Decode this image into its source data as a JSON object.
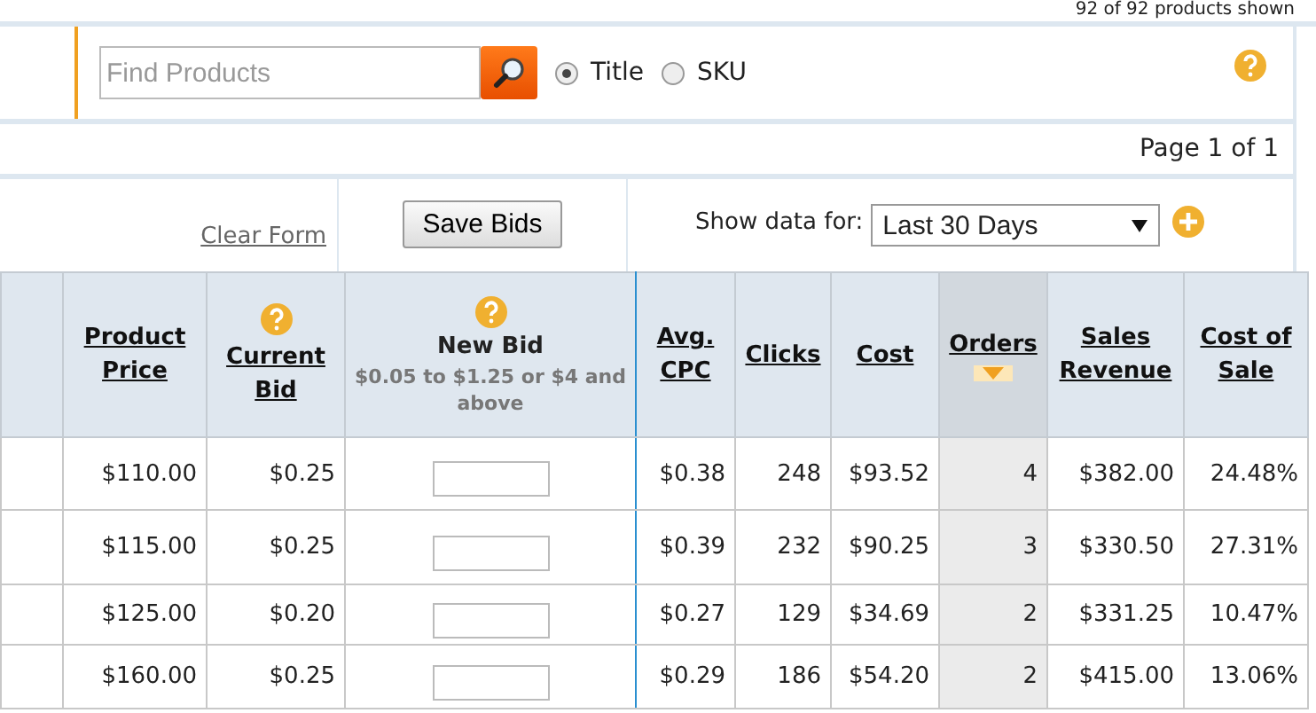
{
  "products_shown": "92 of 92 products shown",
  "search": {
    "placeholder": "Find Products",
    "options": [
      {
        "label": "Title",
        "selected": true
      },
      {
        "label": "SKU",
        "selected": false
      }
    ]
  },
  "pagination": "Page 1 of 1",
  "controls": {
    "clear_form": "Clear Form",
    "save_bids": "Save Bids",
    "show_data_label": "Show data for:",
    "period": "Last 30 Days"
  },
  "table": {
    "columns": [
      {
        "kind": "blank"
      },
      {
        "label": "Product Price",
        "sorted": false,
        "kind": "link"
      },
      {
        "label": "Current Bid",
        "sorted": false,
        "kind": "help-link"
      },
      {
        "label": "New Bid",
        "sorted": false,
        "kind": "help-input",
        "note": "$0.05 to $1.25 or $4 and above"
      },
      {
        "label": "Avg. CPC",
        "sorted": false,
        "kind": "link"
      },
      {
        "label": "Clicks",
        "sorted": false,
        "kind": "link"
      },
      {
        "label": "Cost",
        "sorted": false,
        "kind": "link"
      },
      {
        "label": "Orders",
        "sorted": true,
        "kind": "link"
      },
      {
        "label": "Sales Revenue",
        "sorted": false,
        "kind": "link"
      },
      {
        "label": "Cost of Sale",
        "sorted": false,
        "kind": "link"
      }
    ],
    "rows": [
      [
        "",
        "$110.00",
        "$0.25",
        "",
        "$0.38",
        "248",
        "$93.52",
        "4",
        "$382.00",
        "24.48%"
      ],
      [
        "",
        "$115.00",
        "$0.25",
        "",
        "$0.39",
        "232",
        "$90.25",
        "3",
        "$330.50",
        "27.31%"
      ],
      [
        "",
        "$125.00",
        "$0.20",
        "",
        "$0.27",
        "129",
        "$34.69",
        "2",
        "$331.25",
        "10.47%"
      ],
      [
        "",
        "$160.00",
        "$0.25",
        "",
        "$0.29",
        "186",
        "$54.20",
        "2",
        "$415.00",
        "13.06%"
      ]
    ]
  }
}
